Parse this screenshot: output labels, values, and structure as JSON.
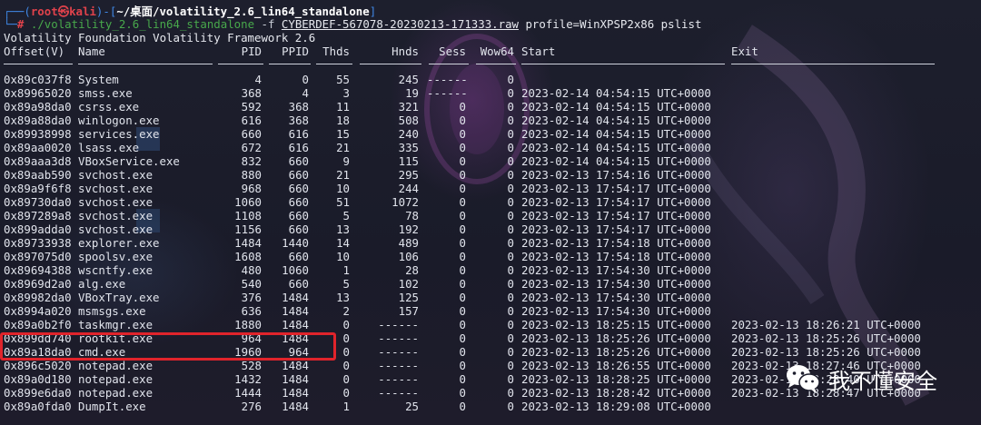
{
  "prompt": {
    "user": "root",
    "at_symbol": "㉿",
    "host": "kali",
    "path": "~/桌面/volatility_2.6_lin64_standalone",
    "hash": "#",
    "exec": "./volatility_2.6_lin64_standalone",
    "flag": "-f",
    "file": "CYBERDEF-567078-20230213-171333.raw",
    "args": "profile=WinXPSP2x86 pslist"
  },
  "banner": "Volatility Foundation Volatility Framework 2.6",
  "columns": {
    "offset": "Offset(V)",
    "name": "Name",
    "pid": "PID",
    "ppid": "PPID",
    "thds": "Thds",
    "hnds": "Hnds",
    "sess": "Sess",
    "wow64": "Wow64",
    "start": "Start",
    "exit": "Exit"
  },
  "processes": [
    {
      "offset": "0x89c037f8",
      "name": "System",
      "pid": "4",
      "ppid": "0",
      "thds": "55",
      "hnds": "245",
      "sess": "------",
      "wow64": "0",
      "start": "",
      "exit": ""
    },
    {
      "offset": "0x89965020",
      "name": "smss.exe",
      "pid": "368",
      "ppid": "4",
      "thds": "3",
      "hnds": "19",
      "sess": "------",
      "wow64": "0",
      "start": "2023-02-14 04:54:15 UTC+0000",
      "exit": ""
    },
    {
      "offset": "0x89a98da0",
      "name": "csrss.exe",
      "pid": "592",
      "ppid": "368",
      "thds": "11",
      "hnds": "321",
      "sess": "0",
      "wow64": "0",
      "start": "2023-02-14 04:54:15 UTC+0000",
      "exit": ""
    },
    {
      "offset": "0x89a88da0",
      "name": "winlogon.exe",
      "pid": "616",
      "ppid": "368",
      "thds": "18",
      "hnds": "508",
      "sess": "0",
      "wow64": "0",
      "start": "2023-02-14 04:54:15 UTC+0000",
      "exit": ""
    },
    {
      "offset": "0x89938998",
      "name": "services.exe",
      "pid": "660",
      "ppid": "616",
      "thds": "15",
      "hnds": "240",
      "sess": "0",
      "wow64": "0",
      "start": "2023-02-14 04:54:15 UTC+0000",
      "exit": ""
    },
    {
      "offset": "0x89aa0020",
      "name": "lsass.exe",
      "pid": "672",
      "ppid": "616",
      "thds": "21",
      "hnds": "335",
      "sess": "0",
      "wow64": "0",
      "start": "2023-02-14 04:54:15 UTC+0000",
      "exit": ""
    },
    {
      "offset": "0x89aaa3d8",
      "name": "VBoxService.exe",
      "pid": "832",
      "ppid": "660",
      "thds": "9",
      "hnds": "115",
      "sess": "0",
      "wow64": "0",
      "start": "2023-02-14 04:54:15 UTC+0000",
      "exit": ""
    },
    {
      "offset": "0x89aab590",
      "name": "svchost.exe",
      "pid": "880",
      "ppid": "660",
      "thds": "21",
      "hnds": "295",
      "sess": "0",
      "wow64": "0",
      "start": "2023-02-13 17:54:16 UTC+0000",
      "exit": ""
    },
    {
      "offset": "0x89a9f6f8",
      "name": "svchost.exe",
      "pid": "968",
      "ppid": "660",
      "thds": "10",
      "hnds": "244",
      "sess": "0",
      "wow64": "0",
      "start": "2023-02-13 17:54:17 UTC+0000",
      "exit": ""
    },
    {
      "offset": "0x89730da0",
      "name": "svchost.exe",
      "pid": "1060",
      "ppid": "660",
      "thds": "51",
      "hnds": "1072",
      "sess": "0",
      "wow64": "0",
      "start": "2023-02-13 17:54:17 UTC+0000",
      "exit": ""
    },
    {
      "offset": "0x897289a8",
      "name": "svchost.exe",
      "pid": "1108",
      "ppid": "660",
      "thds": "5",
      "hnds": "78",
      "sess": "0",
      "wow64": "0",
      "start": "2023-02-13 17:54:17 UTC+0000",
      "exit": ""
    },
    {
      "offset": "0x899adda0",
      "name": "svchost.exe",
      "pid": "1156",
      "ppid": "660",
      "thds": "13",
      "hnds": "192",
      "sess": "0",
      "wow64": "0",
      "start": "2023-02-13 17:54:17 UTC+0000",
      "exit": ""
    },
    {
      "offset": "0x89733938",
      "name": "explorer.exe",
      "pid": "1484",
      "ppid": "1440",
      "thds": "14",
      "hnds": "489",
      "sess": "0",
      "wow64": "0",
      "start": "2023-02-13 17:54:18 UTC+0000",
      "exit": ""
    },
    {
      "offset": "0x897075d0",
      "name": "spoolsv.exe",
      "pid": "1608",
      "ppid": "660",
      "thds": "10",
      "hnds": "106",
      "sess": "0",
      "wow64": "0",
      "start": "2023-02-13 17:54:18 UTC+0000",
      "exit": ""
    },
    {
      "offset": "0x89694388",
      "name": "wscntfy.exe",
      "pid": "480",
      "ppid": "1060",
      "thds": "1",
      "hnds": "28",
      "sess": "0",
      "wow64": "0",
      "start": "2023-02-13 17:54:30 UTC+0000",
      "exit": ""
    },
    {
      "offset": "0x8969d2a0",
      "name": "alg.exe",
      "pid": "540",
      "ppid": "660",
      "thds": "5",
      "hnds": "102",
      "sess": "0",
      "wow64": "0",
      "start": "2023-02-13 17:54:30 UTC+0000",
      "exit": ""
    },
    {
      "offset": "0x89982da0",
      "name": "VBoxTray.exe",
      "pid": "376",
      "ppid": "1484",
      "thds": "13",
      "hnds": "125",
      "sess": "0",
      "wow64": "0",
      "start": "2023-02-13 17:54:30 UTC+0000",
      "exit": ""
    },
    {
      "offset": "0x8994a020",
      "name": "msmsgs.exe",
      "pid": "636",
      "ppid": "1484",
      "thds": "2",
      "hnds": "157",
      "sess": "0",
      "wow64": "0",
      "start": "2023-02-13 17:54:30 UTC+0000",
      "exit": ""
    },
    {
      "offset": "0x89a0b2f0",
      "name": "taskmgr.exe",
      "pid": "1880",
      "ppid": "1484",
      "thds": "0",
      "hnds": "------",
      "sess": "0",
      "wow64": "0",
      "start": "2023-02-13 18:25:15 UTC+0000",
      "exit": "2023-02-13 18:26:21 UTC+0000"
    },
    {
      "offset": "0x899dd740",
      "name": "rootkit.exe",
      "pid": "964",
      "ppid": "1484",
      "thds": "0",
      "hnds": "------",
      "sess": "0",
      "wow64": "0",
      "start": "2023-02-13 18:25:26 UTC+0000",
      "exit": "2023-02-13 18:25:26 UTC+0000"
    },
    {
      "offset": "0x89a18da0",
      "name": "cmd.exe",
      "pid": "1960",
      "ppid": "964",
      "thds": "0",
      "hnds": "------",
      "sess": "0",
      "wow64": "0",
      "start": "2023-02-13 18:25:26 UTC+0000",
      "exit": "2023-02-13 18:25:26 UTC+0000"
    },
    {
      "offset": "0x896c5020",
      "name": "notepad.exe",
      "pid": "528",
      "ppid": "1484",
      "thds": "0",
      "hnds": "------",
      "sess": "0",
      "wow64": "0",
      "start": "2023-02-13 18:26:55 UTC+0000",
      "exit": "2023-02-13 18:27:46 UTC+0000"
    },
    {
      "offset": "0x89a0d180",
      "name": "notepad.exe",
      "pid": "1432",
      "ppid": "1484",
      "thds": "0",
      "hnds": "------",
      "sess": "0",
      "wow64": "0",
      "start": "2023-02-13 18:28:25 UTC+0000",
      "exit": "2023-02-13 18:28:40 UTC+0000"
    },
    {
      "offset": "0x899e6da0",
      "name": "notepad.exe",
      "pid": "1444",
      "ppid": "1484",
      "thds": "0",
      "hnds": "------",
      "sess": "0",
      "wow64": "0",
      "start": "2023-02-13 18:28:42 UTC+0000",
      "exit": "2023-02-13 18:28:47 UTC+0000"
    },
    {
      "offset": "0x89a0fda0",
      "name": "DumpIt.exe",
      "pid": "276",
      "ppid": "1484",
      "thds": "1",
      "hnds": "25",
      "sess": "0",
      "wow64": "0",
      "start": "2023-02-13 18:29:08 UTC+0000",
      "exit": ""
    }
  ],
  "watermark": {
    "text": "我不懂安全",
    "icon": "wechat-icon"
  },
  "colors": {
    "prompt_red": "#e0424b",
    "prompt_blue": "#3f87e4",
    "exec_green": "#48a84b",
    "highlight_red": "#e0242b"
  }
}
